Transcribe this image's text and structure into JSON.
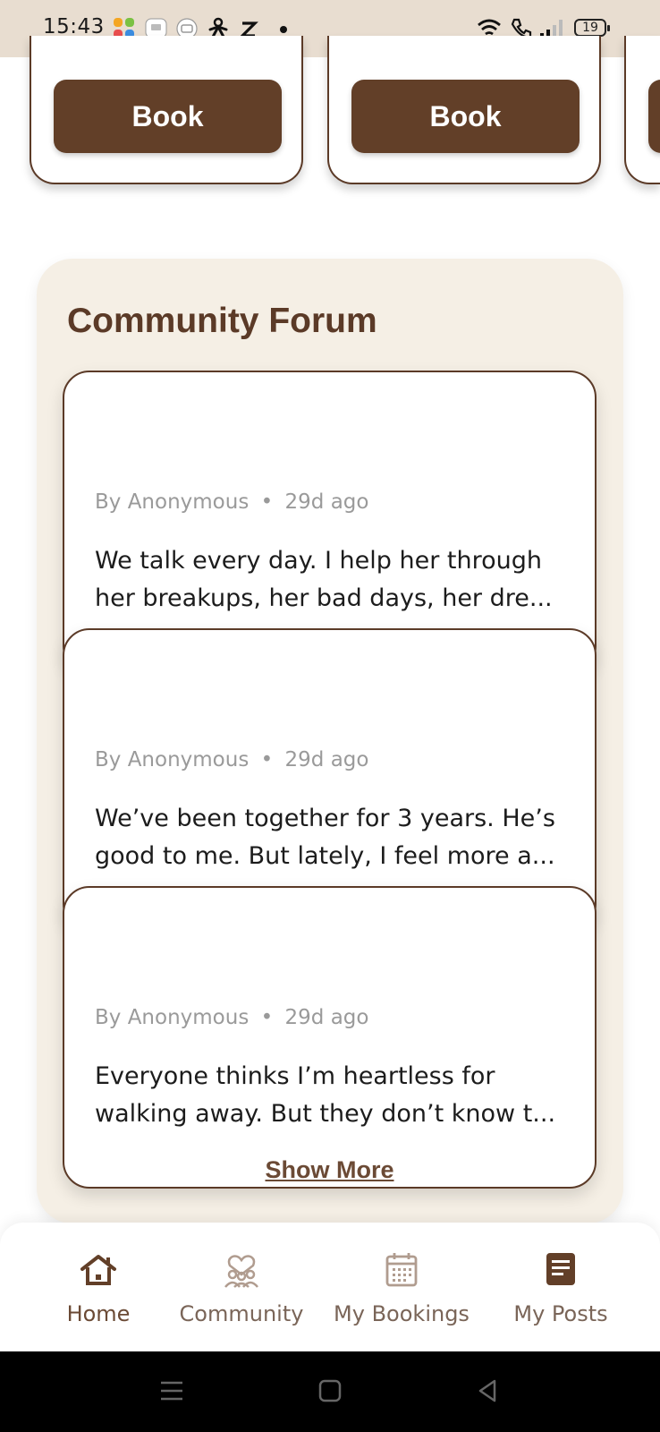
{
  "status_bar": {
    "time": "15:43",
    "battery": "19",
    "icons": [
      "app-grid-icon",
      "chat-app-icon",
      "video-app-icon",
      "accessibility-icon",
      "z-app-icon",
      "notification-dot-icon",
      "wifi-icon",
      "call-icon",
      "signal-icon",
      "battery-icon"
    ]
  },
  "booking_cards": [
    {
      "button_label": "Book"
    },
    {
      "button_label": "Book"
    }
  ],
  "forum": {
    "title": "Community Forum",
    "posts": [
      {
        "author": "By Anonymous",
        "separator": "•",
        "time": "29d ago",
        "excerpt": "We talk every day. I help her through her breakups, her bad days, her dre..."
      },
      {
        "author": "By Anonymous",
        "separator": "•",
        "time": "29d ago",
        "excerpt": "We’ve been together for 3 years. He’s good to me. But lately, I feel more a..."
      },
      {
        "author": "By Anonymous",
        "separator": "•",
        "time": "29d ago",
        "excerpt": "Everyone thinks I’m heartless for walking away. But they don’t know t..."
      }
    ],
    "show_more_label": "Show More"
  },
  "bottom_nav": {
    "items": [
      {
        "label": "Home",
        "icon": "home-icon"
      },
      {
        "label": "Community",
        "icon": "community-icon"
      },
      {
        "label": "My Bookings",
        "icon": "calendar-icon"
      },
      {
        "label": "My Posts",
        "icon": "document-icon"
      }
    ]
  },
  "colors": {
    "brand_brown": "#623f28",
    "panel_bg": "#f5efe5",
    "status_bar_bg": "#e8ddd0"
  }
}
